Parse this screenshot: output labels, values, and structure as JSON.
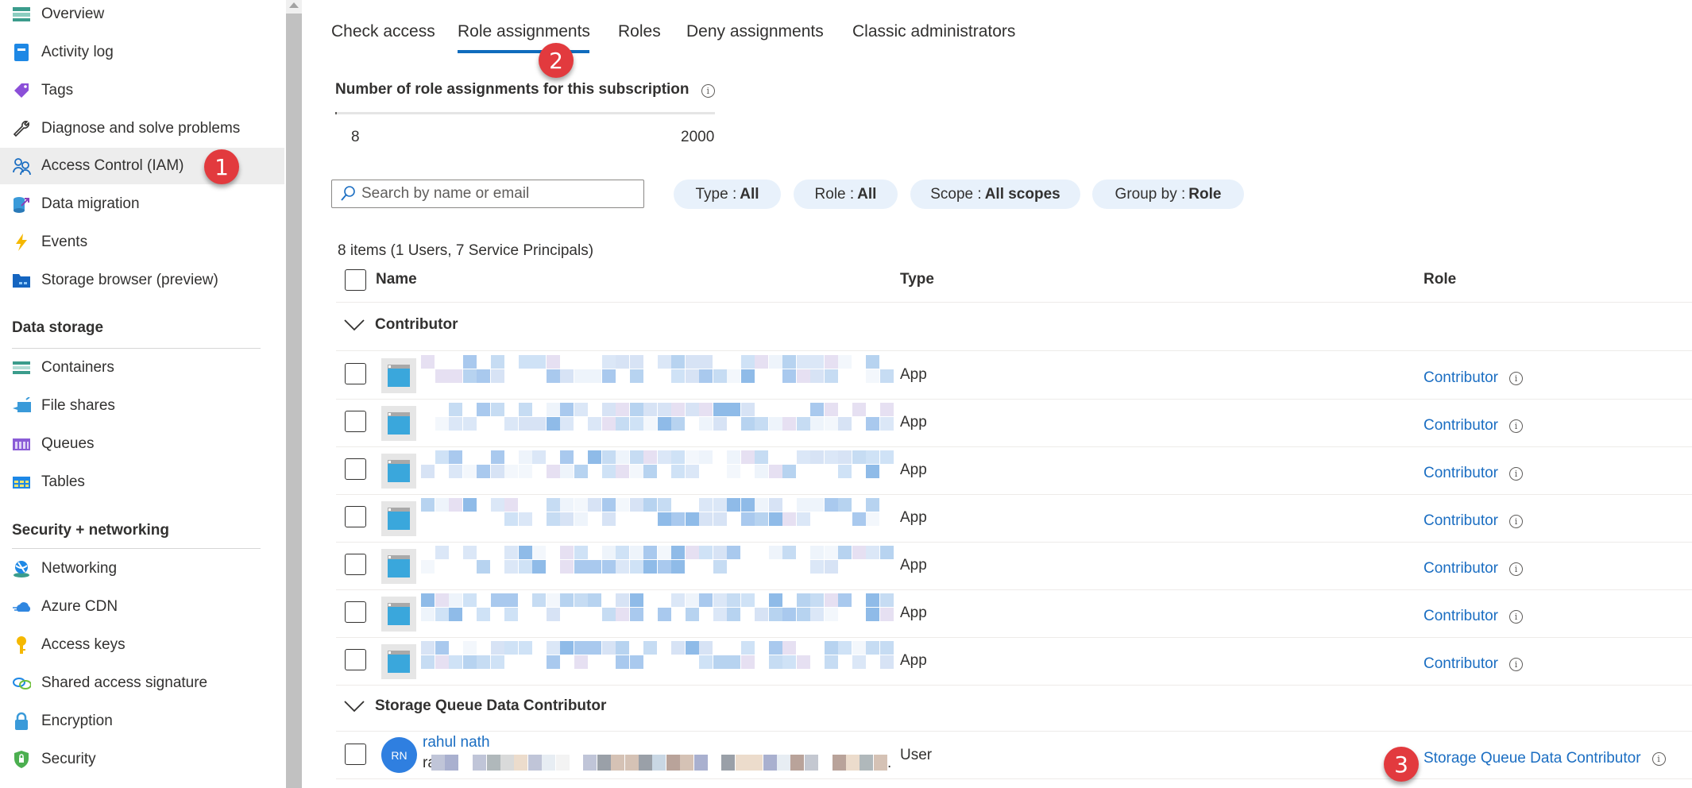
{
  "sidebar": {
    "items": [
      {
        "label": "Overview",
        "icon": "overview-icon"
      },
      {
        "label": "Activity log",
        "icon": "activity-log-icon"
      },
      {
        "label": "Tags",
        "icon": "tag-icon"
      },
      {
        "label": "Diagnose and solve problems",
        "icon": "wrench-icon"
      },
      {
        "label": "Access Control (IAM)",
        "icon": "people-icon",
        "active": true
      },
      {
        "label": "Data migration",
        "icon": "data-migration-icon"
      },
      {
        "label": "Events",
        "icon": "lightning-icon"
      },
      {
        "label": "Storage browser (preview)",
        "icon": "storage-browser-icon"
      }
    ],
    "sections": [
      {
        "title": "Data storage",
        "items": [
          {
            "label": "Containers",
            "icon": "containers-icon"
          },
          {
            "label": "File shares",
            "icon": "file-shares-icon"
          },
          {
            "label": "Queues",
            "icon": "queues-icon"
          },
          {
            "label": "Tables",
            "icon": "tables-icon"
          }
        ]
      },
      {
        "title": "Security + networking",
        "items": [
          {
            "label": "Networking",
            "icon": "networking-icon"
          },
          {
            "label": "Azure CDN",
            "icon": "cloud-icon"
          },
          {
            "label": "Access keys",
            "icon": "key-icon"
          },
          {
            "label": "Shared access signature",
            "icon": "link-icon"
          },
          {
            "label": "Encryption",
            "icon": "lock-icon"
          },
          {
            "label": "Security",
            "icon": "shield-icon"
          }
        ]
      }
    ]
  },
  "annotations": [
    "1",
    "2",
    "3"
  ],
  "tabs": [
    {
      "label": "Check access"
    },
    {
      "label": "Role assignments",
      "active": true
    },
    {
      "label": "Roles"
    },
    {
      "label": "Deny assignments"
    },
    {
      "label": "Classic administrators"
    }
  ],
  "usage": {
    "title": "Number of role assignments for this subscription",
    "current": "8",
    "max": "2000",
    "fraction": 0.004
  },
  "search": {
    "placeholder": "Search by name or email",
    "value": ""
  },
  "filters": [
    {
      "key": "Type :",
      "value": "All"
    },
    {
      "key": "Role :",
      "value": "All"
    },
    {
      "key": "Scope :",
      "value": "All scopes"
    },
    {
      "key": "Group by :",
      "value": "Role"
    }
  ],
  "items_count": "8 items (1 Users, 7 Service Principals)",
  "table": {
    "columns": [
      "Name",
      "Type",
      "Role"
    ],
    "groups": [
      {
        "name": "Contributor",
        "rows": [
          {
            "name": "",
            "type": "App",
            "role": "Contributor"
          },
          {
            "name": "",
            "type": "App",
            "role": "Contributor"
          },
          {
            "name": "",
            "type": "App",
            "role": "Contributor"
          },
          {
            "name": "",
            "type": "App",
            "role": "Contributor"
          },
          {
            "name": "",
            "type": "App",
            "role": "Contributor"
          },
          {
            "name": "",
            "type": "App",
            "role": "Contributor"
          },
          {
            "name": "",
            "type": "App",
            "role": "Contributor"
          }
        ]
      },
      {
        "name": "Storage Queue Data Contributor",
        "rows": [
          {
            "name": "rahul nath",
            "initials": "RN",
            "email_prefix": "ra",
            "email_suffix": ".",
            "type": "User",
            "role": "Storage Queue Data Contributor"
          }
        ]
      }
    ]
  },
  "colors": {
    "accent": "#0f6cbd",
    "link": "#1b6ec2",
    "badge": "#e23a3e",
    "pill_bg": "#e8f1fb",
    "avatar": "#2f7fe0"
  }
}
